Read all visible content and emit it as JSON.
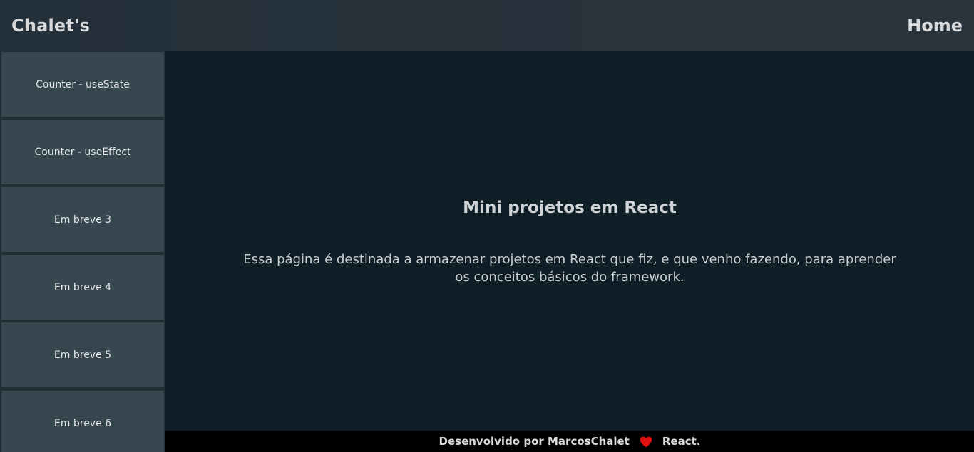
{
  "header": {
    "brand": "Chalet's",
    "home_link": "Home"
  },
  "sidebar": {
    "items": [
      {
        "label": "Counter - useState"
      },
      {
        "label": "Counter - useEffect"
      },
      {
        "label": "Em breve 3"
      },
      {
        "label": "Em breve 4"
      },
      {
        "label": "Em breve 5"
      },
      {
        "label": "Em breve 6"
      }
    ]
  },
  "main": {
    "title": "Mini projetos em React",
    "description": "Essa página é destinada a armazenar projetos em React que fiz, e que venho fazendo, para aprender os conceitos básicos do framework."
  },
  "footer": {
    "text_before": "Desenvolvido por MarcosChalet",
    "heart_icon": "heart-icon",
    "heart_color": "#e01010",
    "text_after": "React."
  }
}
